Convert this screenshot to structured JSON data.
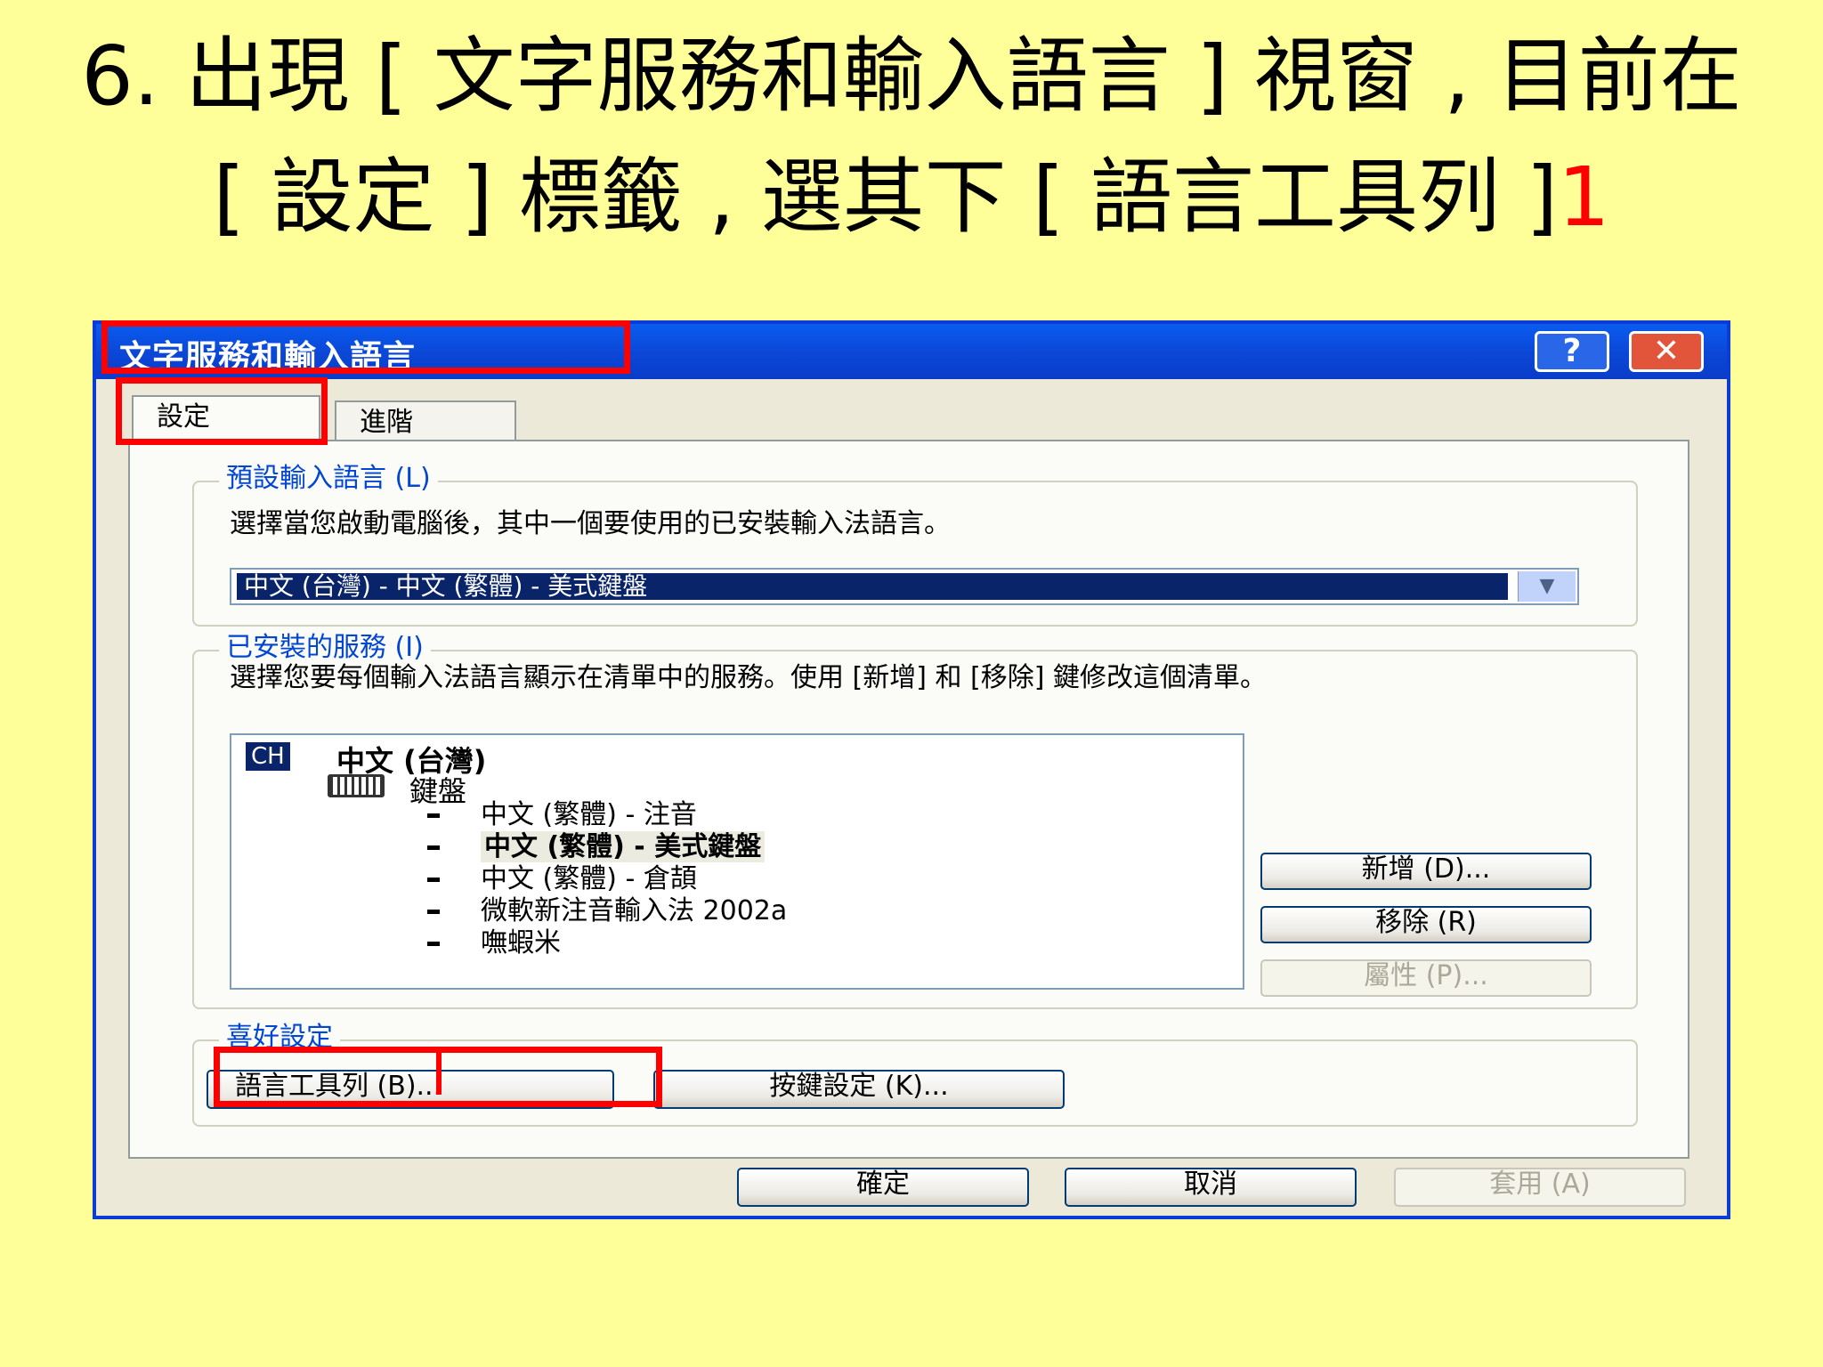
{
  "slide": {
    "title_prefix": "6. 出現 [ 文字服務和輸入語言 ] 視窗 , 目前在 [ 設定 ] 標籤 , 選其下 [ 語言工具列 ]",
    "title_suffix": "1"
  },
  "dialog": {
    "title": "文字服務和輸入語言",
    "help_label": "?",
    "close_label": "✕",
    "tabs": [
      {
        "label": "設定",
        "selected": true
      },
      {
        "label": "進階",
        "selected": false
      }
    ],
    "default_language": {
      "legend": "預設輸入語言 (L)",
      "description": "選擇當您啟動電腦後，其中一個要使用的已安裝輸入法語言。",
      "selected_value": "中文 (台灣) - 中文 (繁體) - 美式鍵盤",
      "dropdown_icon": "chevron-down-icon"
    },
    "installed_services": {
      "legend": "已安裝的服務 (I)",
      "description": "選擇您要每個輸入法語言顯示在清單中的服務。使用 [新增] 和 [移除] 鍵修改這個清單。",
      "language_code": "CH",
      "language_name": "中文 (台灣)",
      "category_label": "鍵盤",
      "items": [
        "中文 (繁體) - 注音",
        "中文 (繁體) - 美式鍵盤",
        "中文 (繁體) - 倉頡",
        "微軟新注音輸入法 2002a",
        "嘸蝦米"
      ],
      "selected_index": 1,
      "add_label": "新增 (D)...",
      "remove_label": "移除 (R)",
      "properties_label": "屬性 (P)..."
    },
    "preferences": {
      "legend": "喜好設定",
      "language_bar_label": "語言工具列 (B)...",
      "key_settings_label": "按鍵設定 (K)..."
    },
    "footer": {
      "ok_label": "確定",
      "cancel_label": "取消",
      "apply_label": "套用 (A)"
    }
  },
  "colors": {
    "slide_background": "#ffff99",
    "highlight": "#ff0000",
    "titlebar": "#0a48d8",
    "legend_text": "#0046d5",
    "selection": "#0a246a"
  }
}
